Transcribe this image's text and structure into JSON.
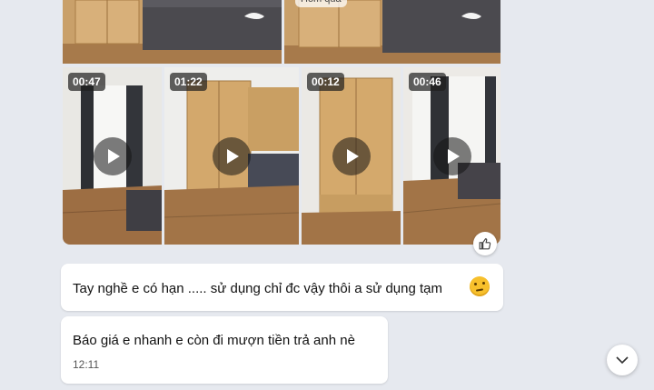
{
  "chat": {
    "top_label": "Hôm qua",
    "videos": [
      {
        "duration": "00:47"
      },
      {
        "duration": "01:22"
      },
      {
        "duration": "00:12"
      },
      {
        "duration": "00:46"
      }
    ],
    "icons": {
      "like": "thumbs-up-icon",
      "play": "play-icon",
      "scroll": "chevron-down-icon"
    },
    "messages": [
      {
        "text": "Tay nghề e có hạn ..... sử dụng chỉ đc vậy thôi a sử dụng tạm",
        "emoji": "thinking-face-emoji"
      },
      {
        "text": "Báo giá e nhanh e còn đi mượn tiền trả anh nè",
        "time": "12:11"
      }
    ]
  }
}
